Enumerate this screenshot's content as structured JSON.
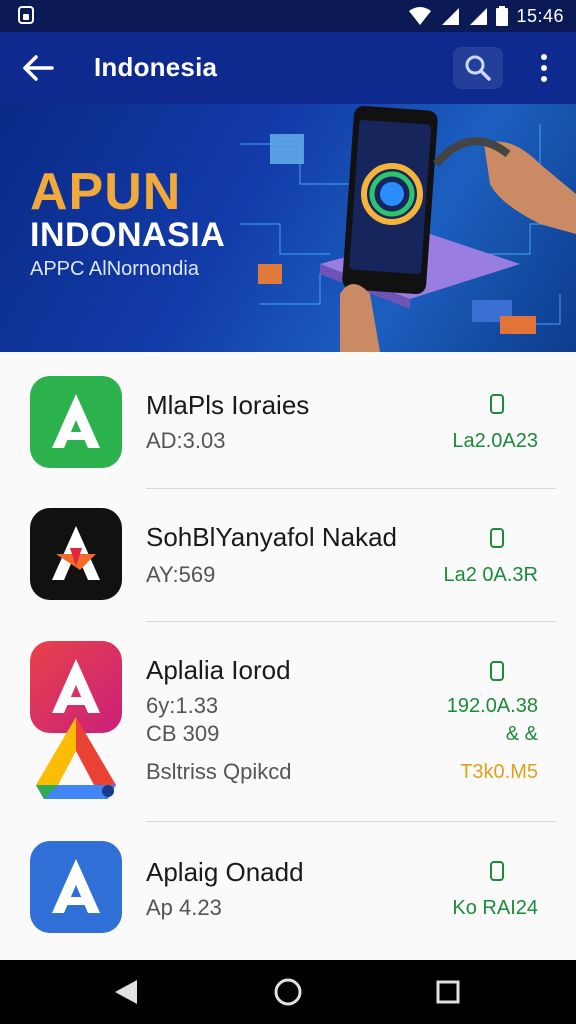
{
  "status_bar": {
    "time": "15:46",
    "icons": [
      "lock-icon",
      "wifi-icon",
      "signal-icon",
      "signal-icon",
      "battery-icon"
    ]
  },
  "app_bar": {
    "title": "Indonesia",
    "back_icon": "arrow-left-icon",
    "search_icon": "search-icon",
    "menu_icon": "more-vert-icon"
  },
  "banner": {
    "title_line1": "APUN",
    "title_line2": "INDONASIA",
    "subtitle": "APPC AlNornondia"
  },
  "apps": [
    {
      "name": "MlaPls Ioraies",
      "meta": [
        "AD:3.03"
      ],
      "status": [
        "La2.0A23"
      ],
      "icon": "app-icon-green"
    },
    {
      "name": "SohBlYanyafol Nakad",
      "meta": [
        "AY:569"
      ],
      "status": [
        "La2 0A.3R"
      ],
      "icon": "app-icon-black"
    },
    {
      "name": "Aplalia Iorod",
      "meta": [
        "6y:1.33",
        "CB 309",
        "Bsltriss Qpikcd"
      ],
      "status": [
        "192.0A.38",
        "& &",
        "T3k0.M5"
      ],
      "icon": "app-icon-red"
    },
    {
      "name": "Aplaig Onadd",
      "meta": [
        "Ap 4.23"
      ],
      "status": [
        "Ko RAI24"
      ],
      "icon": "app-icon-blue"
    }
  ],
  "colors": {
    "app_bar": "#0e2a8f",
    "status_bar": "#0b1a55",
    "accent_green": "#1d8a3a",
    "accent_orange": "#e0a21c",
    "banner_title": "#f2a93b"
  },
  "nav_bar": {
    "icons": [
      "back-triangle-icon",
      "home-circle-icon",
      "recents-square-icon"
    ]
  }
}
